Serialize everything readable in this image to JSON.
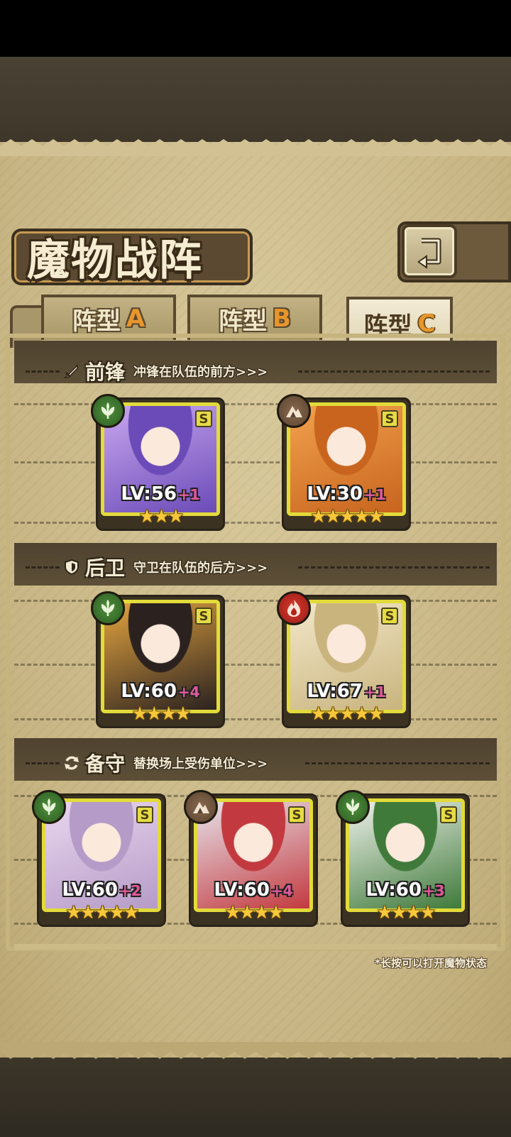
{
  "header": {
    "title": "魔物战阵"
  },
  "tabs": [
    {
      "label": "阵型",
      "suffix": "A",
      "active": false
    },
    {
      "label": "阵型",
      "suffix": "B",
      "active": false
    },
    {
      "label": "阵型",
      "suffix": "C",
      "active": true
    }
  ],
  "sections": [
    {
      "title": "前锋",
      "subtitle": "冲锋在队伍的前方>>>",
      "icon": "sword-icon",
      "units": [
        {
          "element": "grass",
          "rank": "S",
          "level": "LV:56",
          "bonus": "+1",
          "stars": "★★★",
          "portrait_colors": [
            "#c9a7ef",
            "#6b4bb8"
          ]
        },
        {
          "element": "earth",
          "rank": "S",
          "level": "LV:30",
          "bonus": "+1",
          "stars": "★★★★★",
          "portrait_colors": [
            "#f1a24e",
            "#c8641e"
          ]
        }
      ]
    },
    {
      "title": "后卫",
      "subtitle": "守卫在队伍的后方>>>",
      "icon": "shield-icon",
      "units": [
        {
          "element": "grass",
          "rank": "S",
          "level": "LV:60",
          "bonus": "+4",
          "stars": "★★★★",
          "portrait_colors": [
            "#e3a43f",
            "#2b2220"
          ]
        },
        {
          "element": "fire",
          "rank": "S",
          "level": "LV:67",
          "bonus": "+1",
          "stars": "★★★★★",
          "portrait_colors": [
            "#f2e7c9",
            "#c9b47e"
          ]
        }
      ]
    },
    {
      "title": "备守",
      "subtitle": "替换场上受伤单位>>>",
      "icon": "swap-icon",
      "units": [
        {
          "element": "grass",
          "rank": "S",
          "level": "LV:60",
          "bonus": "+2",
          "stars": "★★★★★",
          "portrait_colors": [
            "#ead7ef",
            "#b59bc7"
          ]
        },
        {
          "element": "earth",
          "rank": "S",
          "level": "LV:60",
          "bonus": "+4",
          "stars": "★★★★",
          "portrait_colors": [
            "#e7e2ea",
            "#c23a3f"
          ]
        },
        {
          "element": "grass",
          "rank": "S",
          "level": "LV:60",
          "bonus": "+3",
          "stars": "★★★★",
          "portrait_colors": [
            "#eef0ea",
            "#3f7a3a"
          ]
        }
      ]
    }
  ],
  "footer": {
    "hint": "*长按可以打开魔物状态"
  }
}
